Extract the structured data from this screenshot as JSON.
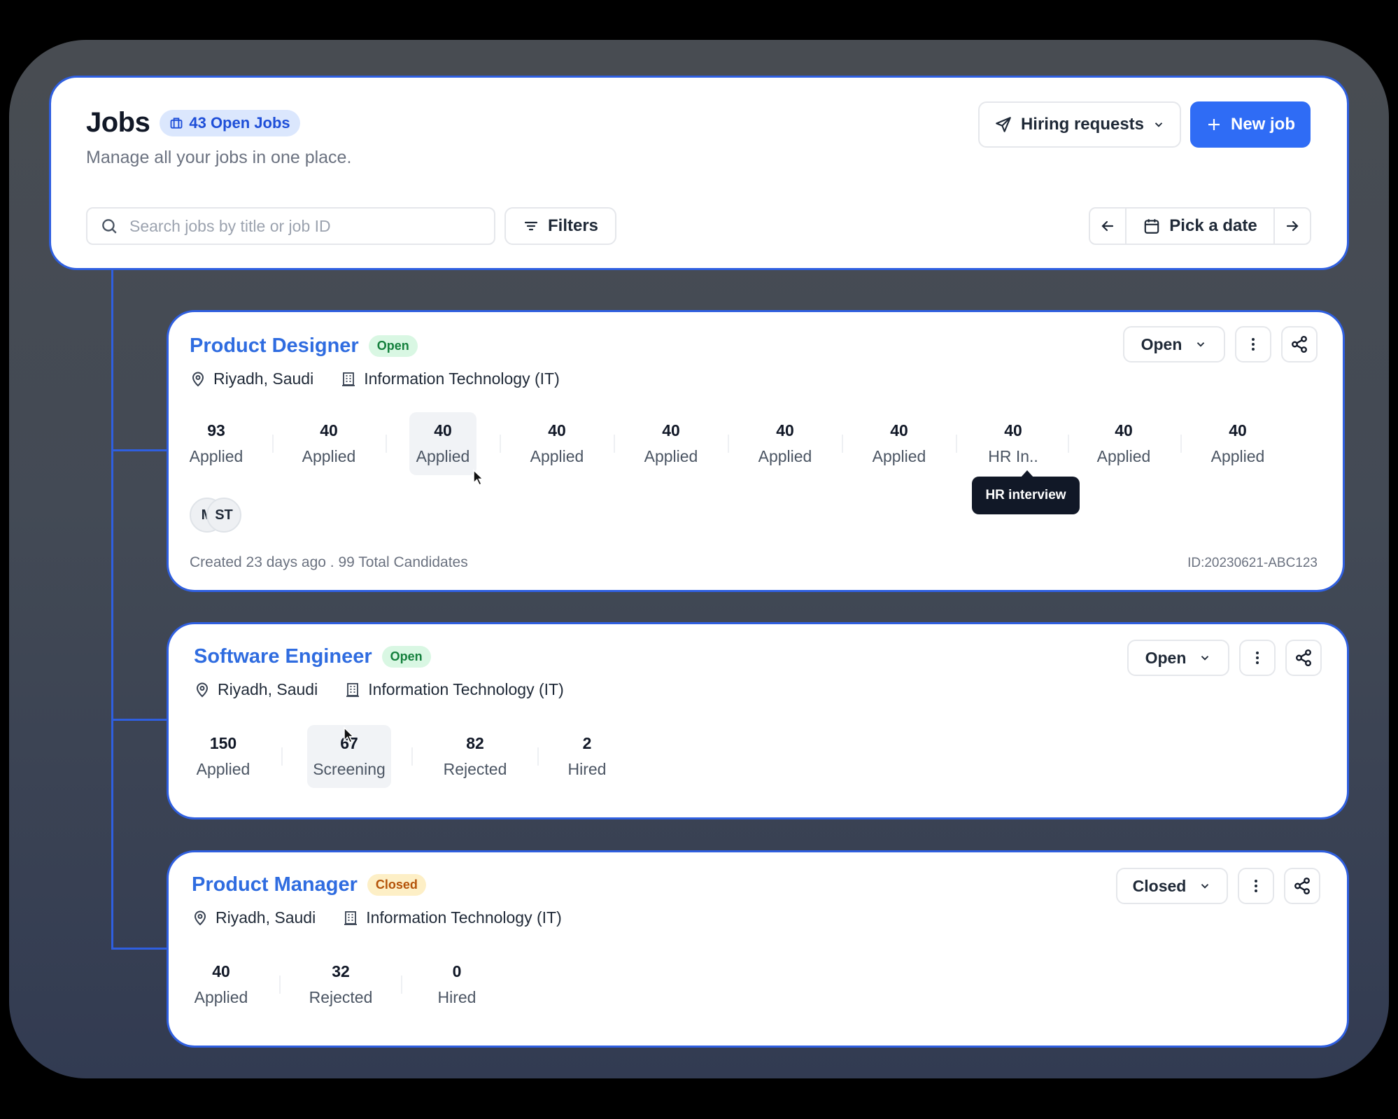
{
  "header": {
    "title": "Jobs",
    "open_jobs_badge": "43 Open Jobs",
    "subtitle": "Manage all your jobs in one place.",
    "hiring_requests_label": "Hiring requests",
    "new_job_label": "New job",
    "search_placeholder": "Search jobs by title or job ID",
    "search_value": "",
    "filters_label": "Filters",
    "date_picker_label": "Pick a date"
  },
  "colors": {
    "accent": "#2f6cf5",
    "border_highlight": "#2f5fe0",
    "open_pill_bg": "#d9f7e3",
    "open_pill_text": "#15803d",
    "closed_pill_bg": "#fdefc6",
    "closed_pill_text": "#b45309"
  },
  "jobs": [
    {
      "title": "Product Designer",
      "status_pill": "Open",
      "location": "Riyadh, Saudi",
      "department": "Information Technology (IT)",
      "status_select": "Open",
      "stages": [
        {
          "count": "93",
          "label": "Applied"
        },
        {
          "count": "40",
          "label": "Applied"
        },
        {
          "count": "40",
          "label": "Applied"
        },
        {
          "count": "40",
          "label": "Applied"
        },
        {
          "count": "40",
          "label": "Applied"
        },
        {
          "count": "40",
          "label": "Applied"
        },
        {
          "count": "40",
          "label": "Applied"
        },
        {
          "count": "40",
          "label": "HR In.."
        },
        {
          "count": "40",
          "label": "Applied"
        },
        {
          "count": "40",
          "label": "Applied"
        }
      ],
      "tooltip": "HR interview",
      "avatars": [
        "M",
        "ST"
      ],
      "footer": "Created 23 days ago . 99 Total Candidates",
      "job_id": "ID:20230621-ABC123"
    },
    {
      "title": "Software Engineer",
      "status_pill": "Open",
      "location": "Riyadh, Saudi",
      "department": "Information Technology (IT)",
      "status_select": "Open",
      "stages": [
        {
          "count": "150",
          "label": "Applied"
        },
        {
          "count": "67",
          "label": "Screening"
        },
        {
          "count": "82",
          "label": "Rejected"
        },
        {
          "count": "2",
          "label": "Hired"
        }
      ]
    },
    {
      "title": "Product Manager",
      "status_pill": "Closed",
      "location": "Riyadh, Saudi",
      "department": "Information Technology (IT)",
      "status_select": "Closed",
      "stages": [
        {
          "count": "40",
          "label": "Applied"
        },
        {
          "count": "32",
          "label": "Rejected"
        },
        {
          "count": "0",
          "label": "Hired"
        }
      ]
    }
  ],
  "icons": {
    "badge": "briefcase-icon",
    "hiring": "send-icon",
    "new_job": "plus-icon",
    "search": "search-icon",
    "filters": "filter-icon",
    "date_prev": "arrow-left-icon",
    "date": "calendar-icon",
    "date_next": "arrow-right-icon",
    "location": "map-pin-icon",
    "department": "building-icon",
    "more": "more-vertical-icon",
    "share": "share-icon",
    "dropdown": "chevron-down-icon"
  }
}
